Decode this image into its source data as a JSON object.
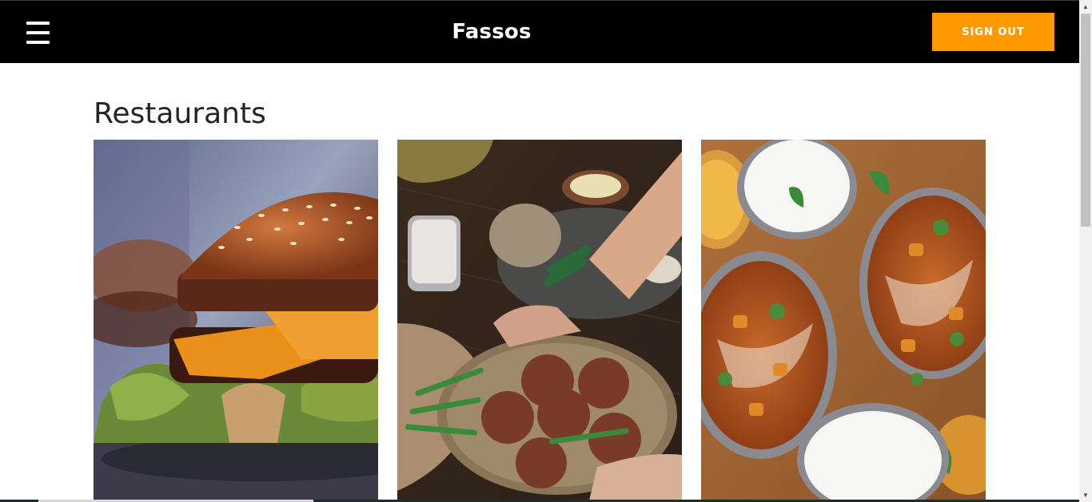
{
  "header": {
    "brand": "Fassos",
    "signout_label": "SIGN OUT",
    "menu_icon": "hamburger-menu-icon",
    "accent_color": "#ff9900",
    "background_color": "#000000"
  },
  "main": {
    "title": "Restaurants",
    "cards": [
      {
        "image": "burger-photo"
      },
      {
        "image": "fried-snacks-photo"
      },
      {
        "image": "curry-and-rice-photo"
      }
    ]
  }
}
